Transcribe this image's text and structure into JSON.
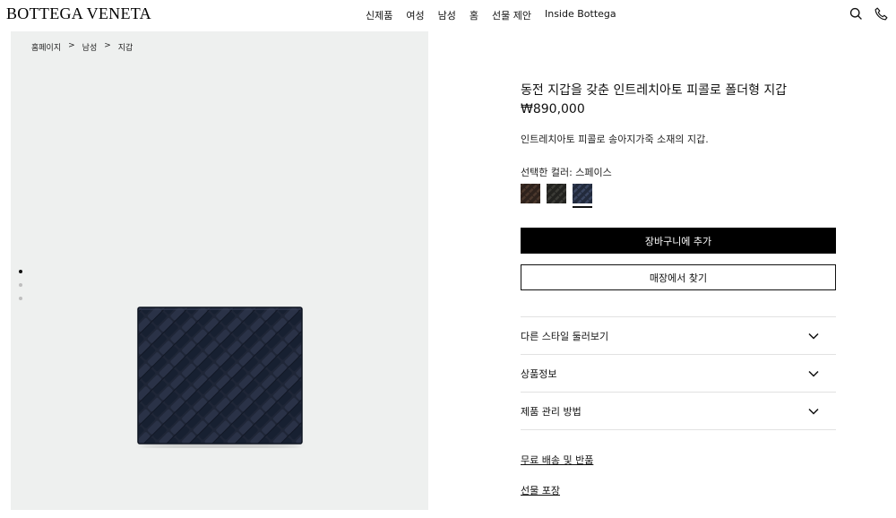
{
  "header": {
    "logo": "BOTTEGA VENETA",
    "nav": [
      "신제품",
      "여성",
      "남성",
      "홈",
      "선물 제안",
      "Inside Bottega"
    ],
    "icons": [
      "search-icon",
      "phone-icon"
    ]
  },
  "breadcrumb": [
    "홈페이지",
    ">",
    "남성",
    ">",
    "지갑"
  ],
  "gallery": {
    "image_count": 3,
    "active_index": 0
  },
  "product": {
    "title": "동전 지갑을 갖춘 인트레치아토 피콜로 폴더형 지갑",
    "price": "₩890,000",
    "description": "인트레치아토 피콜로 송아지가죽 소재의 지갑.",
    "color_label": "선택한 컬러: 스페이스",
    "swatches": [
      {
        "color": "#3a2a22",
        "selected": false
      },
      {
        "color": "#2a2a26",
        "selected": false
      },
      {
        "color": "#2b3245",
        "selected": true
      }
    ],
    "add_to_cart": "장바구니에 추가",
    "find_in_store": "매장에서 찾기"
  },
  "accordion": [
    "다른 스타일 둘러보기",
    "상품정보",
    "제품 관리 방법"
  ],
  "links": {
    "shipping": "무료 배송 및 반품",
    "gift": "선물 포장"
  },
  "colors": {
    "wallet": "#1f2637",
    "background": "#eef0ef"
  }
}
